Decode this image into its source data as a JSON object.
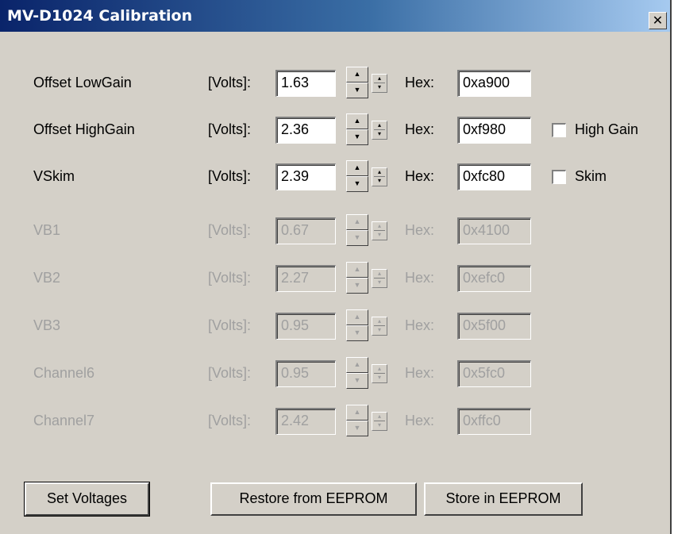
{
  "window": {
    "title": "MV-D1024 Calibration",
    "close_label": "✕"
  },
  "common": {
    "unit_label": "[Volts]:",
    "hex_label": "Hex:"
  },
  "rows": [
    {
      "name": "Offset LowGain",
      "volts": "1.63",
      "hex": "0xa900",
      "enabled": true
    },
    {
      "name": "Offset HighGain",
      "volts": "2.36",
      "hex": "0xf980",
      "enabled": true,
      "checkbox_label": "High Gain",
      "checked": false
    },
    {
      "name": "VSkim",
      "volts": "2.39",
      "hex": "0xfc80",
      "enabled": true,
      "checkbox_label": "Skim",
      "checked": false
    },
    {
      "name": "VB1",
      "volts": "0.67",
      "hex": "0x4100",
      "enabled": false
    },
    {
      "name": "VB2",
      "volts": "2.27",
      "hex": "0xefc0",
      "enabled": false
    },
    {
      "name": "VB3",
      "volts": "0.95",
      "hex": "0x5f00",
      "enabled": false
    },
    {
      "name": "Channel6",
      "volts": "0.95",
      "hex": "0x5fc0",
      "enabled": false
    },
    {
      "name": "Channel7",
      "volts": "2.42",
      "hex": "0xffc0",
      "enabled": false
    }
  ],
  "buttons": {
    "set_voltages": "Set Voltages",
    "restore": "Restore from EEPROM",
    "store": "Store in EEPROM"
  },
  "icons": {
    "spin_up": "▲",
    "spin_down": "▼",
    "mini_up": "▴",
    "mini_down": "▾"
  }
}
